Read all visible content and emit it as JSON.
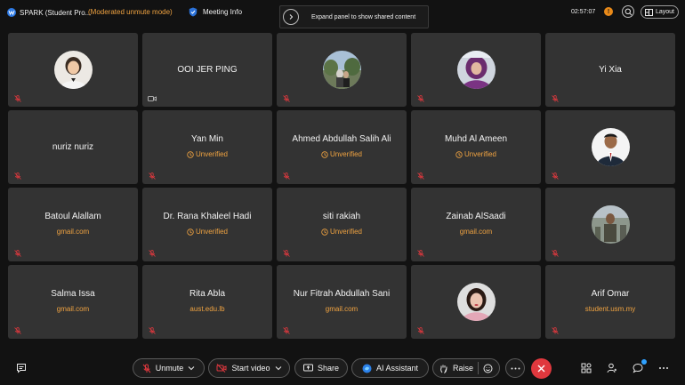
{
  "topbar": {
    "app_title": "SPARK (Student Pro...",
    "mode": "(Moderated unmute mode)",
    "meeting_info": "Meeting Info",
    "expand_text": "Expand panel to show shared content",
    "time": "02:57:07",
    "layout_label": "Layout"
  },
  "participants": [
    {
      "name": "",
      "sub": "",
      "type": "avatar",
      "avatar": "woman-portrait"
    },
    {
      "name": "OOI JER PING",
      "sub": "",
      "type": "name",
      "camera_off": true
    },
    {
      "name": "",
      "sub": "",
      "type": "avatar",
      "avatar": "outdoor-photo"
    },
    {
      "name": "",
      "sub": "",
      "type": "avatar",
      "avatar": "woman-purple-scarf"
    },
    {
      "name": "Yi Xia",
      "sub": "",
      "type": "name"
    },
    {
      "name": "nuriz nuriz",
      "sub": "",
      "type": "name"
    },
    {
      "name": "Yan Min",
      "sub": "Unverified",
      "type": "unverified"
    },
    {
      "name": "Ahmed Abdullah Salih Ali",
      "sub": "Unverified",
      "type": "unverified"
    },
    {
      "name": "Muhd Al Ameen",
      "sub": "Unverified",
      "type": "unverified"
    },
    {
      "name": "",
      "sub": "",
      "type": "avatar",
      "avatar": "man-suit"
    },
    {
      "name": "Batoul Alallam",
      "sub": "gmail.com",
      "type": "domain"
    },
    {
      "name": "Dr. Rana Khaleel Hadi",
      "sub": "Unverified",
      "type": "unverified"
    },
    {
      "name": "siti rakiah",
      "sub": "Unverified",
      "type": "unverified"
    },
    {
      "name": "Zainab AlSaadi",
      "sub": "gmail.com",
      "type": "domain"
    },
    {
      "name": "",
      "sub": "",
      "type": "avatar",
      "avatar": "man-outdoors"
    },
    {
      "name": "Salma Issa",
      "sub": "gmail.com",
      "type": "domain"
    },
    {
      "name": "Rita Abla",
      "sub": "aust.edu.lb",
      "type": "domain"
    },
    {
      "name": "Nur Fitrah Abdullah Sani",
      "sub": "gmail.com",
      "type": "domain"
    },
    {
      "name": "",
      "sub": "",
      "type": "avatar",
      "avatar": "woman-pink"
    },
    {
      "name": "Arif Omar",
      "sub": "student.usm.my",
      "type": "domain"
    }
  ],
  "controls": {
    "unmute": "Unmute",
    "start_video": "Start video",
    "share": "Share",
    "ai_assistant": "AI Assistant",
    "raise": "Raise"
  },
  "colors": {
    "accent_orange": "#f0a341",
    "end_red": "#e0383e",
    "tile_bg": "#333333",
    "bg": "#121212"
  }
}
